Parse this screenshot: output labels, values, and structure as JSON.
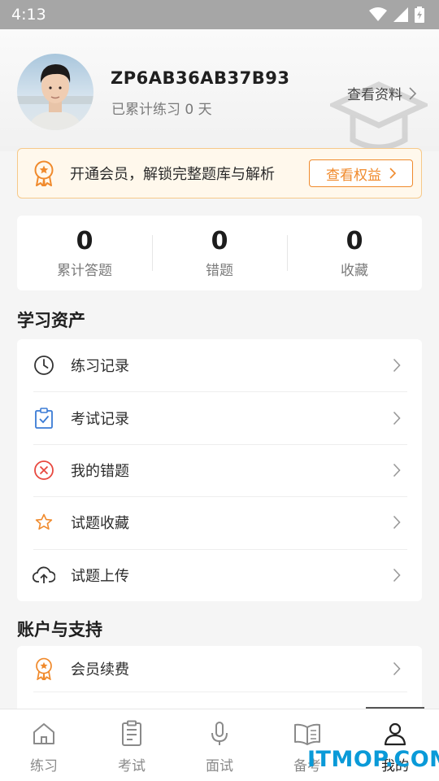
{
  "status_bar": {
    "time": "4:13"
  },
  "profile": {
    "username": "ZP6AB36AB37B93",
    "practice_days": "已累计练习 0 天",
    "view_profile_label": "查看资料"
  },
  "vip": {
    "text": "开通会员，解锁完整题库与解析",
    "button_label": "查看权益",
    "accent": "#f08a2c"
  },
  "stats": [
    {
      "value": "0",
      "label": "累计答题"
    },
    {
      "value": "0",
      "label": "错题"
    },
    {
      "value": "0",
      "label": "收藏"
    }
  ],
  "study_assets": {
    "title": "学习资产",
    "items": [
      {
        "label": "练习记录",
        "icon": "clock-icon"
      },
      {
        "label": "考试记录",
        "icon": "clipboard-check-icon"
      },
      {
        "label": "我的错题",
        "icon": "x-circle-icon"
      },
      {
        "label": "试题收藏",
        "icon": "star-icon"
      },
      {
        "label": "试题上传",
        "icon": "cloud-upload-icon"
      }
    ]
  },
  "account_support": {
    "title": "账户与支持",
    "items": [
      {
        "label": "会员续费",
        "icon": "medal-icon"
      }
    ]
  },
  "tabbar": {
    "items": [
      {
        "label": "练习",
        "icon": "home-icon"
      },
      {
        "label": "考试",
        "icon": "document-icon"
      },
      {
        "label": "面试",
        "icon": "microphone-icon"
      },
      {
        "label": "备考",
        "icon": "book-icon"
      },
      {
        "label": "我的",
        "icon": "person-icon"
      }
    ],
    "active_index": 4
  },
  "watermark": "ITMOP.COM"
}
